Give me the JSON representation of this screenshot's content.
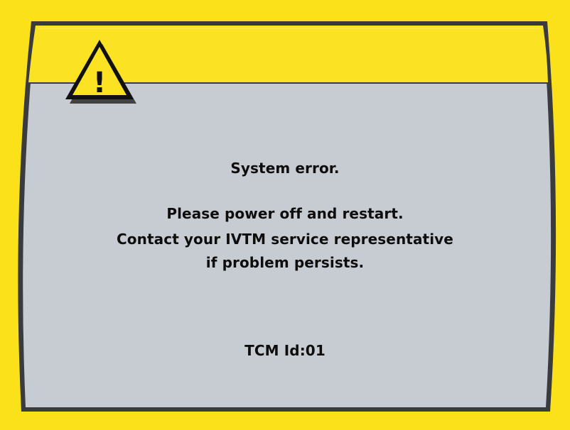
{
  "dialog": {
    "headline": "System error.",
    "instruction_line_1": "Please power off and restart.",
    "instruction_line_2": "Contact your IVTM service representative",
    "instruction_line_3": "if problem persists.",
    "device_id": "TCM Id:01"
  },
  "icons": {
    "warning": "warning-triangle-icon",
    "warning_glyph": "!"
  },
  "colors": {
    "bezel": "#fae11a",
    "header_band": "#fbe223",
    "panel": "#c7cbd2",
    "frame_border": "#3a3b3f",
    "text": "#0d0d0d"
  }
}
